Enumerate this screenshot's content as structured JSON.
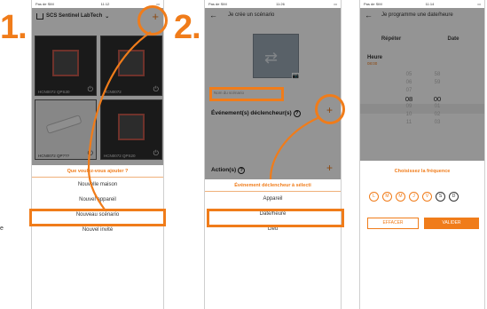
{
  "steps": {
    "one": "1.",
    "two": "2."
  },
  "side_text": "e",
  "phone1": {
    "status_left": "Pas de SIM",
    "status_time": "11:12",
    "header_title": "SCS Sentinel LabTech",
    "plus_icon": "+",
    "tiles": [
      {
        "label": "HCN0072 QPS30"
      },
      {
        "label": "HCN0072"
      },
      {
        "label": "HCN0072 QP???"
      },
      {
        "label": "HCN0072 QPS20"
      }
    ],
    "sheet_title": "Que voulez-vous ajouter ?",
    "sheet_items": [
      "Nouvelle maison",
      "Nouvel appareil",
      "Nouveau scénario",
      "Nouvel invité"
    ]
  },
  "phone2": {
    "status_left": "Pas de SIM",
    "status_time": "11:26",
    "title": "Je crée un scénario",
    "name_placeholder": "Nom du scénario",
    "triggers_label": "Événement(s) déclencheur(s)",
    "actions_label": "Action(s)",
    "help_icon": "?",
    "sheet_title": "Événement déclencheur à sélecti",
    "sheet_items": [
      "Appareil",
      "Date/heure",
      "Lieu"
    ]
  },
  "phone3": {
    "status_left": "Pas de SIM",
    "status_time": "11:14",
    "title": "Je programme une date/heure",
    "tabs": [
      "Répéter",
      "Date"
    ],
    "heure_label": "Heure",
    "heure_value": "08:00",
    "hours": [
      "05",
      "06",
      "07",
      "08",
      "09",
      "10",
      "11"
    ],
    "minutes": [
      "58",
      "59",
      "",
      "00",
      "01",
      "02",
      "03"
    ],
    "freq_title": "Choisissez la fréquence",
    "days": [
      "L",
      "M",
      "M",
      "J",
      "V",
      "S",
      "D"
    ],
    "btn_clear": "EFFACER",
    "btn_validate": "VALIDER"
  },
  "colors": {
    "accent": "#f07c1a"
  }
}
